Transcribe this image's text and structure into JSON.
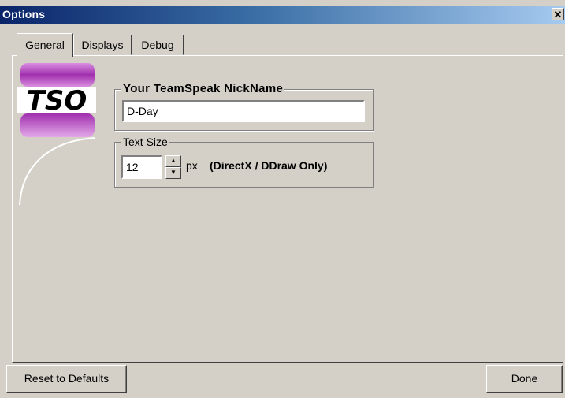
{
  "window": {
    "title": "Options"
  },
  "tabs": [
    {
      "label": "General",
      "active": true
    },
    {
      "label": "Displays",
      "active": false
    },
    {
      "label": "Debug",
      "active": false
    }
  ],
  "logo": {
    "text": "TSO",
    "colors": {
      "purple": "#b03ab8",
      "white": "#ffffff"
    }
  },
  "nickname": {
    "legend": "Your TeamSpeak NickName",
    "value": "D-Day"
  },
  "text_size": {
    "legend": "Text Size",
    "value": "12",
    "unit": "px",
    "note": "(DirectX / DDraw Only)"
  },
  "buttons": {
    "reset": "Reset to Defaults",
    "done": "Done"
  },
  "colors": {
    "title_bar_start": "#0a246a",
    "title_bar_end": "#a6caf0",
    "face": "#d4d0c8"
  }
}
